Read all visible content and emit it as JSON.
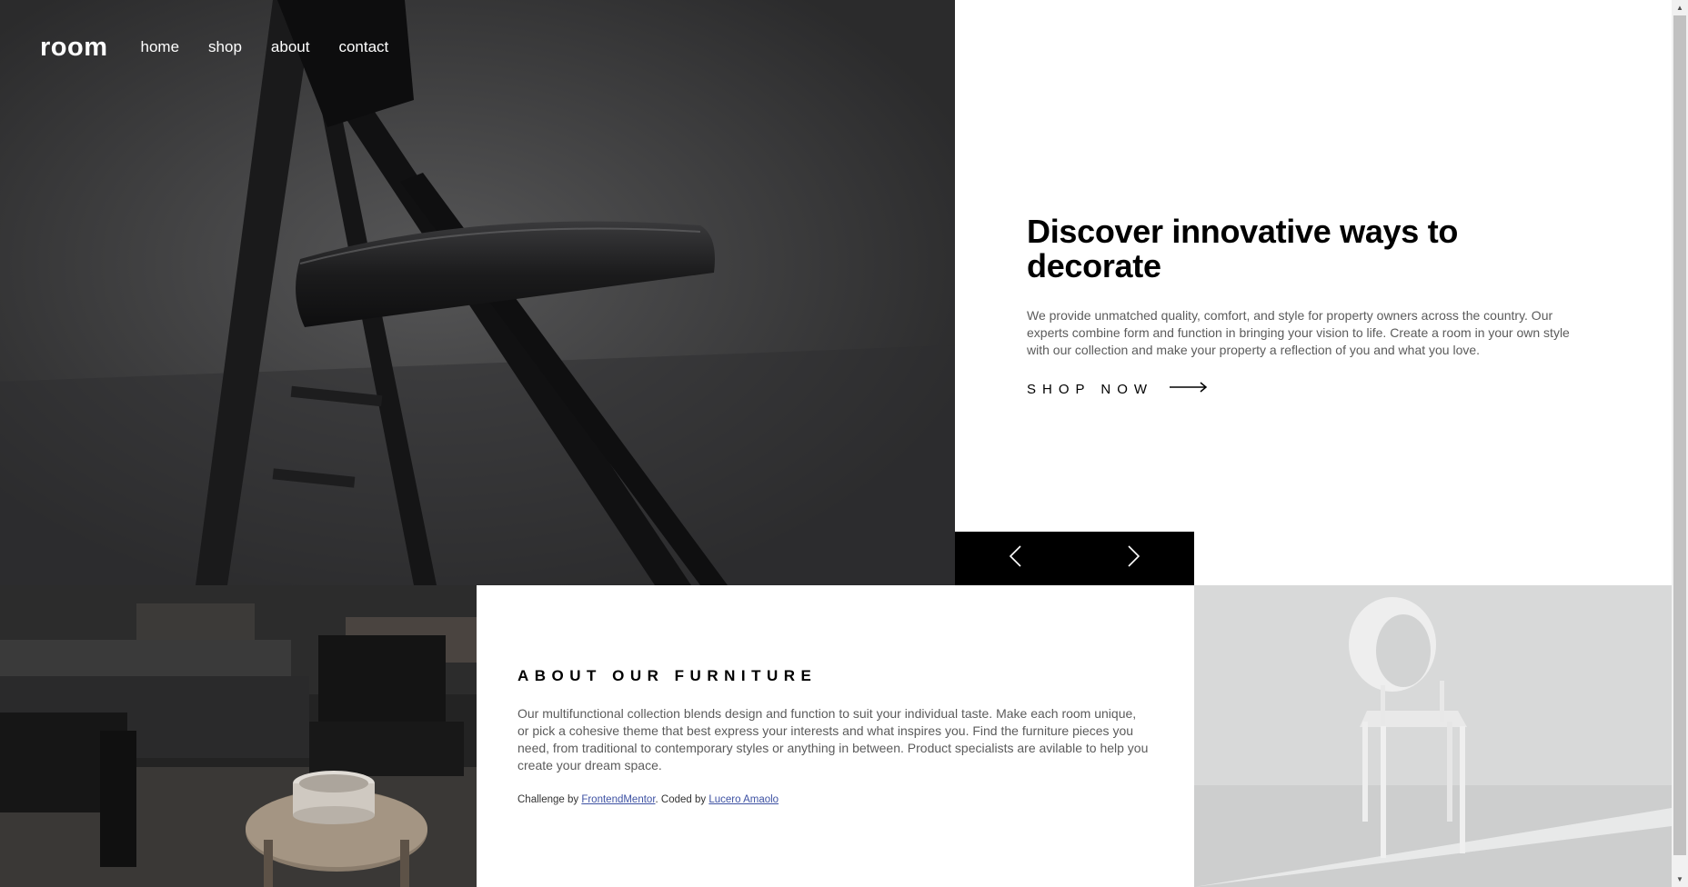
{
  "nav": {
    "logo": "room",
    "links": [
      "home",
      "shop",
      "about",
      "contact"
    ]
  },
  "hero": {
    "title": "Discover innovative ways to decorate",
    "description": "We provide unmatched quality, comfort, and style for property owners across the country. Our experts combine form and function in bringing your vision to life. Create a room in your own style with our collection and make your property a reflection of you and what you love.",
    "cta_label": "SHOP NOW",
    "cta_icon": "arrow-right-icon",
    "image_alt": "black folding chair"
  },
  "slider": {
    "prev_icon": "chevron-left-icon",
    "next_icon": "chevron-right-icon"
  },
  "about": {
    "title": "ABOUT OUR FURNITURE",
    "description": "Our multifunctional collection blends design and function to suit your individual taste. Make each room unique, or pick a cohesive theme that best express your interests and what inspires you. Find the furniture pieces you need, from traditional to contemporary styles or anything in between. Product specialists are avilable to help you create your dream space.",
    "attribution": {
      "prefix": "Challenge by ",
      "link1": "FrontendMentor",
      "middle": ". Coded by ",
      "link2": "Lucero Amaolo"
    }
  },
  "colors": {
    "accent": "#000000",
    "text_muted": "#5b5b5b",
    "link": "#3e52a3"
  }
}
